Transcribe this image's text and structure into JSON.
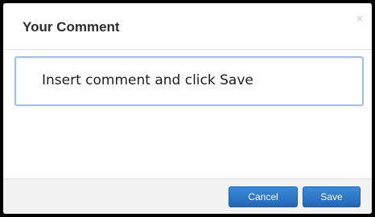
{
  "dialog": {
    "title": "Your Comment",
    "close_glyph": "×",
    "close_icon": "close-icon"
  },
  "comment": {
    "placeholder": "Insert comment and click Save"
  },
  "footer": {
    "cancel_label": "Cancel",
    "save_label": "Save"
  },
  "colors": {
    "button_primary": "#2f7bc9",
    "input_border": "#9fc0e4",
    "footer_background": "#f2f2f2"
  }
}
